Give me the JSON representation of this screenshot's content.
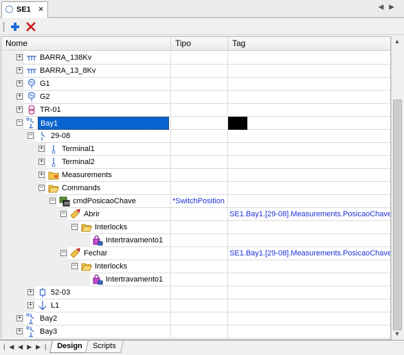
{
  "document_tab": {
    "title": "SE1",
    "close": "×"
  },
  "tab_nav": {
    "left": "◀",
    "right": "▶"
  },
  "toolbar": {
    "add_icon": "plus-icon",
    "delete_icon": "delete-x-icon"
  },
  "columns": {
    "nome": "Nome",
    "tipo": "Tipo",
    "tag": "Tag"
  },
  "rows": [
    {
      "label": "BARRA_138Kv",
      "icon": "busbar",
      "expander": "+",
      "tipo": "",
      "tag": ""
    },
    {
      "label": "BARRA_13_8Kv",
      "icon": "busbar",
      "expander": "+",
      "tipo": "",
      "tag": ""
    },
    {
      "label": "G1",
      "icon": "generator",
      "expander": "+",
      "tipo": "",
      "tag": ""
    },
    {
      "label": "G2",
      "icon": "generator",
      "expander": "+",
      "tipo": "",
      "tag": ""
    },
    {
      "label": "TR-01",
      "icon": "transformer",
      "expander": "+",
      "tipo": "",
      "tag": ""
    },
    {
      "label": "Bay1",
      "icon": "bay",
      "expander": "−",
      "tipo": "",
      "tag": ""
    },
    {
      "label": "29-08",
      "icon": "switch",
      "expander": "−",
      "tipo": "",
      "tag": ""
    },
    {
      "label": "Terminal1",
      "icon": "terminal",
      "expander": "+",
      "tipo": "",
      "tag": ""
    },
    {
      "label": "Terminal2",
      "icon": "terminal",
      "expander": "+",
      "tipo": "",
      "tag": ""
    },
    {
      "label": "Measurements",
      "icon": "folder",
      "expander": "+",
      "tipo": "",
      "tag": ""
    },
    {
      "label": "Commands",
      "icon": "folder-open",
      "expander": "−",
      "tipo": "",
      "tag": ""
    },
    {
      "label": "cmdPosicaoChave",
      "icon": "command",
      "expander": "−",
      "tipo": "*SwitchPosition",
      "tag": ""
    },
    {
      "label": "Abrir",
      "icon": "action",
      "expander": "−",
      "tipo": "",
      "tag": "SE1.Bay1.[29-08].Measurements.PosicaoChave"
    },
    {
      "label": "Interlocks",
      "icon": "folder-open",
      "expander": "−",
      "tipo": "",
      "tag": ""
    },
    {
      "label": "Intertravamento1",
      "icon": "interlock",
      "expander": "",
      "tipo": "",
      "tag": ""
    },
    {
      "label": "Fechar",
      "icon": "action",
      "expander": "−",
      "tipo": "",
      "tag": "SE1.Bay1.[29-08].Measurements.PosicaoChave"
    },
    {
      "label": "Interlocks",
      "icon": "folder-open",
      "expander": "−",
      "tipo": "",
      "tag": ""
    },
    {
      "label": "Intertravamento1",
      "icon": "interlock",
      "expander": "",
      "tipo": "",
      "tag": ""
    },
    {
      "label": "52-03",
      "icon": "breaker",
      "expander": "+",
      "tipo": "",
      "tag": ""
    },
    {
      "label": "L1",
      "icon": "line",
      "expander": "+",
      "tipo": "",
      "tag": ""
    },
    {
      "label": "Bay2",
      "icon": "bay",
      "expander": "+",
      "tipo": "",
      "tag": ""
    },
    {
      "label": "Bay3",
      "icon": "bay",
      "expander": "+",
      "tipo": "",
      "tag": ""
    }
  ],
  "selected_row": "Bay1",
  "pager": {
    "first": "|◀",
    "prev": "◀",
    "next": "▶",
    "last": "▶|"
  },
  "bottom_tabs": {
    "design": "Design",
    "scripts": "Scripts"
  },
  "colors": {
    "selection": "#0a64d0",
    "link_text": "#1a2fd6",
    "add": "#1a6fd6",
    "delete": "#c81a1a"
  }
}
